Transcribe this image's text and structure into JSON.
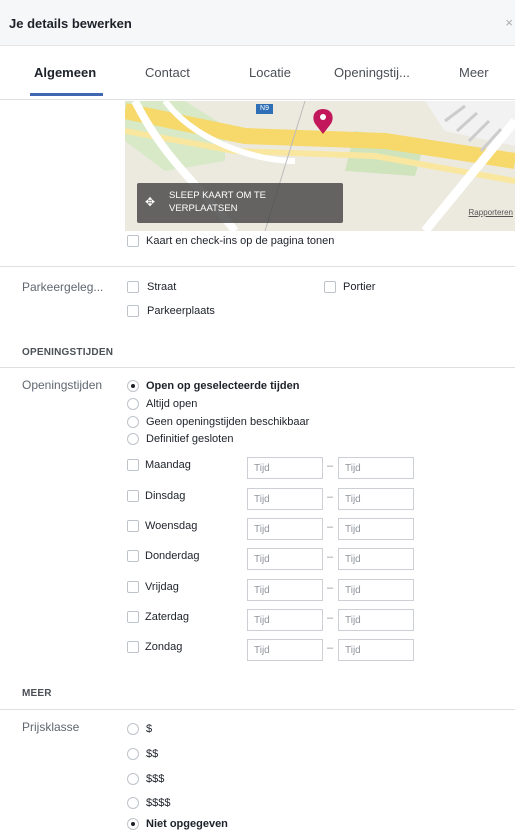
{
  "header": {
    "title": "Je details bewerken",
    "close_icon": "close-icon"
  },
  "tabs": [
    {
      "label": "Algemeen",
      "active": true
    },
    {
      "label": "Contact"
    },
    {
      "label": "Locatie"
    },
    {
      "label": "Openingstij..."
    },
    {
      "label": "Meer"
    }
  ],
  "map": {
    "drag_label": "SLEEP KAART OM TE VERPLAATSEN",
    "report_label": "Rapporteren",
    "road_badge": "N9",
    "pin_color": "#c2185b",
    "show_checkin_label": "Kaart en check-ins op de pagina tonen"
  },
  "parking": {
    "label": "Parkeergeleg...",
    "options": [
      "Straat",
      "Portier",
      "Parkeerplaats"
    ]
  },
  "hours_section": {
    "title": "OPENINGSTIJDEN",
    "label": "Openingstijden",
    "modes": [
      {
        "label": "Open op geselecteerde tijden",
        "checked": true
      },
      {
        "label": "Altijd open"
      },
      {
        "label": "Geen openingstijden beschikbaar"
      },
      {
        "label": "Definitief gesloten"
      }
    ],
    "placeholder": "Tijd",
    "dash": "–",
    "days": [
      "Maandag",
      "Dinsdag",
      "Woensdag",
      "Donderdag",
      "Vrijdag",
      "Zaterdag",
      "Zondag"
    ]
  },
  "more_section": {
    "title": "MEER",
    "price_label": "Prijsklasse",
    "price_options": [
      {
        "label": "$"
      },
      {
        "label": "$$"
      },
      {
        "label": "$$$"
      },
      {
        "label": "$$$$"
      },
      {
        "label": "Niet opgegeven",
        "checked": true
      }
    ]
  }
}
